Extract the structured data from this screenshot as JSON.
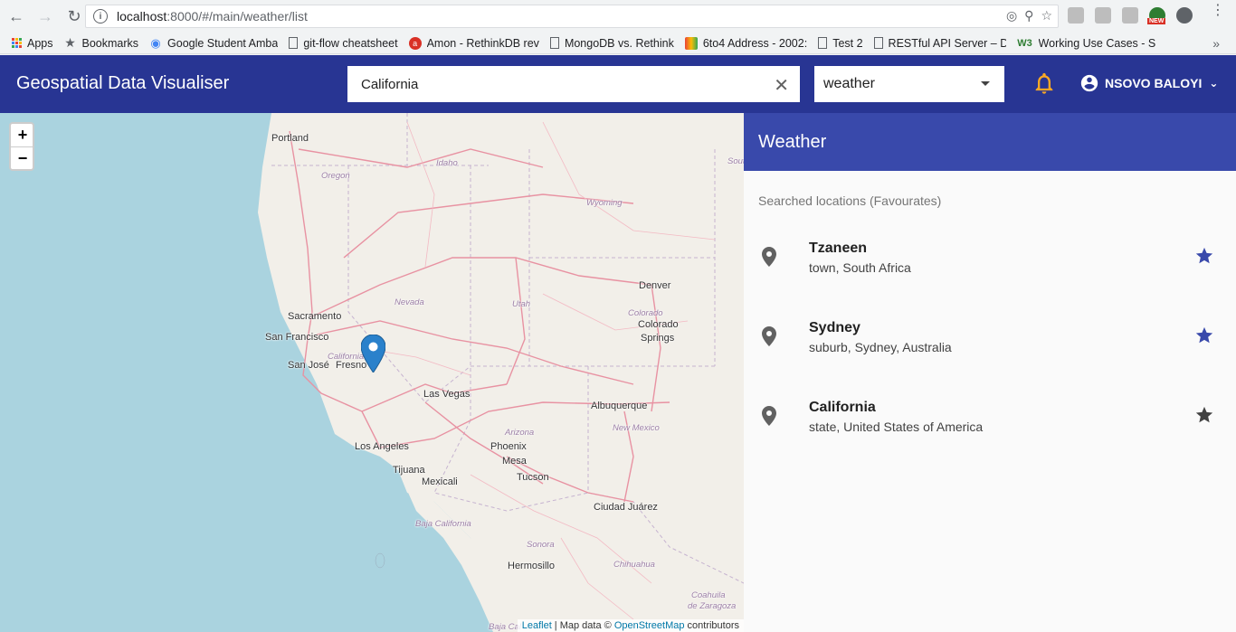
{
  "browser": {
    "url_host": "localhost",
    "url_path": ":8000/#/main/weather/list",
    "bookmarks": [
      {
        "label": "Apps",
        "icon": "apps-icon"
      },
      {
        "label": "Bookmarks",
        "icon": "star-icon"
      },
      {
        "label": "Google Student Amba",
        "icon": "google-icon"
      },
      {
        "label": "git-flow cheatsheet",
        "icon": "page-icon"
      },
      {
        "label": "Amon - RethinkDB rev",
        "icon": "amon-icon"
      },
      {
        "label": "MongoDB vs. Rethink",
        "icon": "page-icon"
      },
      {
        "label": "6to4 Address - 2002:",
        "icon": "colorful-icon"
      },
      {
        "label": "Test 2",
        "icon": "page-icon"
      },
      {
        "label": "RESTful API Server – D",
        "icon": "page-icon"
      },
      {
        "label": "Working Use Cases - S",
        "icon": "w3-icon"
      }
    ],
    "more_label": "»",
    "new_badge": "NEW"
  },
  "app": {
    "title": "Geospatial Data Visualiser",
    "search_value": "California",
    "select_value": "weather",
    "user_name": "NSOVO BALOYI"
  },
  "map": {
    "zoom_in": "+",
    "zoom_out": "−",
    "labels": [
      {
        "text": "Portland",
        "kind": "city"
      },
      {
        "text": "Oregon",
        "kind": "region"
      },
      {
        "text": "Idaho",
        "kind": "region"
      },
      {
        "text": "Wyoming",
        "kind": "region"
      },
      {
        "text": "Nevada",
        "kind": "region"
      },
      {
        "text": "Utah",
        "kind": "region"
      },
      {
        "text": "Colorado",
        "kind": "region"
      },
      {
        "text": "Denver",
        "kind": "city"
      },
      {
        "text": "Colorado",
        "kind": "city"
      },
      {
        "text": "Springs",
        "kind": "city"
      },
      {
        "text": "Sacramento",
        "kind": "city"
      },
      {
        "text": "San Francisco",
        "kind": "city"
      },
      {
        "text": "California",
        "kind": "region"
      },
      {
        "text": "San José",
        "kind": "city"
      },
      {
        "text": "Fresno",
        "kind": "city"
      },
      {
        "text": "Las Vegas",
        "kind": "city"
      },
      {
        "text": "Albuquerque",
        "kind": "city"
      },
      {
        "text": "New Mexico",
        "kind": "region"
      },
      {
        "text": "Arizona",
        "kind": "region"
      },
      {
        "text": "Los Angeles",
        "kind": "city"
      },
      {
        "text": "Phoenix",
        "kind": "city"
      },
      {
        "text": "Mesa",
        "kind": "city"
      },
      {
        "text": "Tijuana",
        "kind": "city"
      },
      {
        "text": "Mexicali",
        "kind": "city"
      },
      {
        "text": "Tucson",
        "kind": "city"
      },
      {
        "text": "Ciudad Juárez",
        "kind": "city"
      },
      {
        "text": "Baja California",
        "kind": "region"
      },
      {
        "text": "Sonora",
        "kind": "region"
      },
      {
        "text": "Chihuahua",
        "kind": "region"
      },
      {
        "text": "Hermosillo",
        "kind": "city"
      },
      {
        "text": "Coahuila",
        "kind": "region"
      },
      {
        "text": "de Zaragoza",
        "kind": "region"
      },
      {
        "text": "Baja Cal",
        "kind": "region"
      },
      {
        "text": "Sout",
        "kind": "region"
      }
    ],
    "attribution_leaflet": "Leaflet",
    "attribution_text": " | Map data © ",
    "attribution_osm": "OpenStreetMap",
    "attribution_tail": " contributors"
  },
  "panel": {
    "title": "Weather",
    "subtitle": "Searched locations (Favourates)",
    "locations": [
      {
        "name": "Tzaneen",
        "desc": "town, South Africa",
        "favourite": true,
        "star_color": "#3949ab"
      },
      {
        "name": "Sydney",
        "desc": "suburb, Sydney, Australia",
        "favourite": true,
        "star_color": "#3949ab"
      },
      {
        "name": "California",
        "desc": "state, United States of America",
        "favourite": true,
        "star_color": "#424242"
      }
    ]
  },
  "colors": {
    "header": "#283593",
    "panel_header": "#3949ab",
    "bell": "#f9a825",
    "marker": "#2a81cb",
    "water": "#aad3df",
    "land": "#f2efe9"
  }
}
